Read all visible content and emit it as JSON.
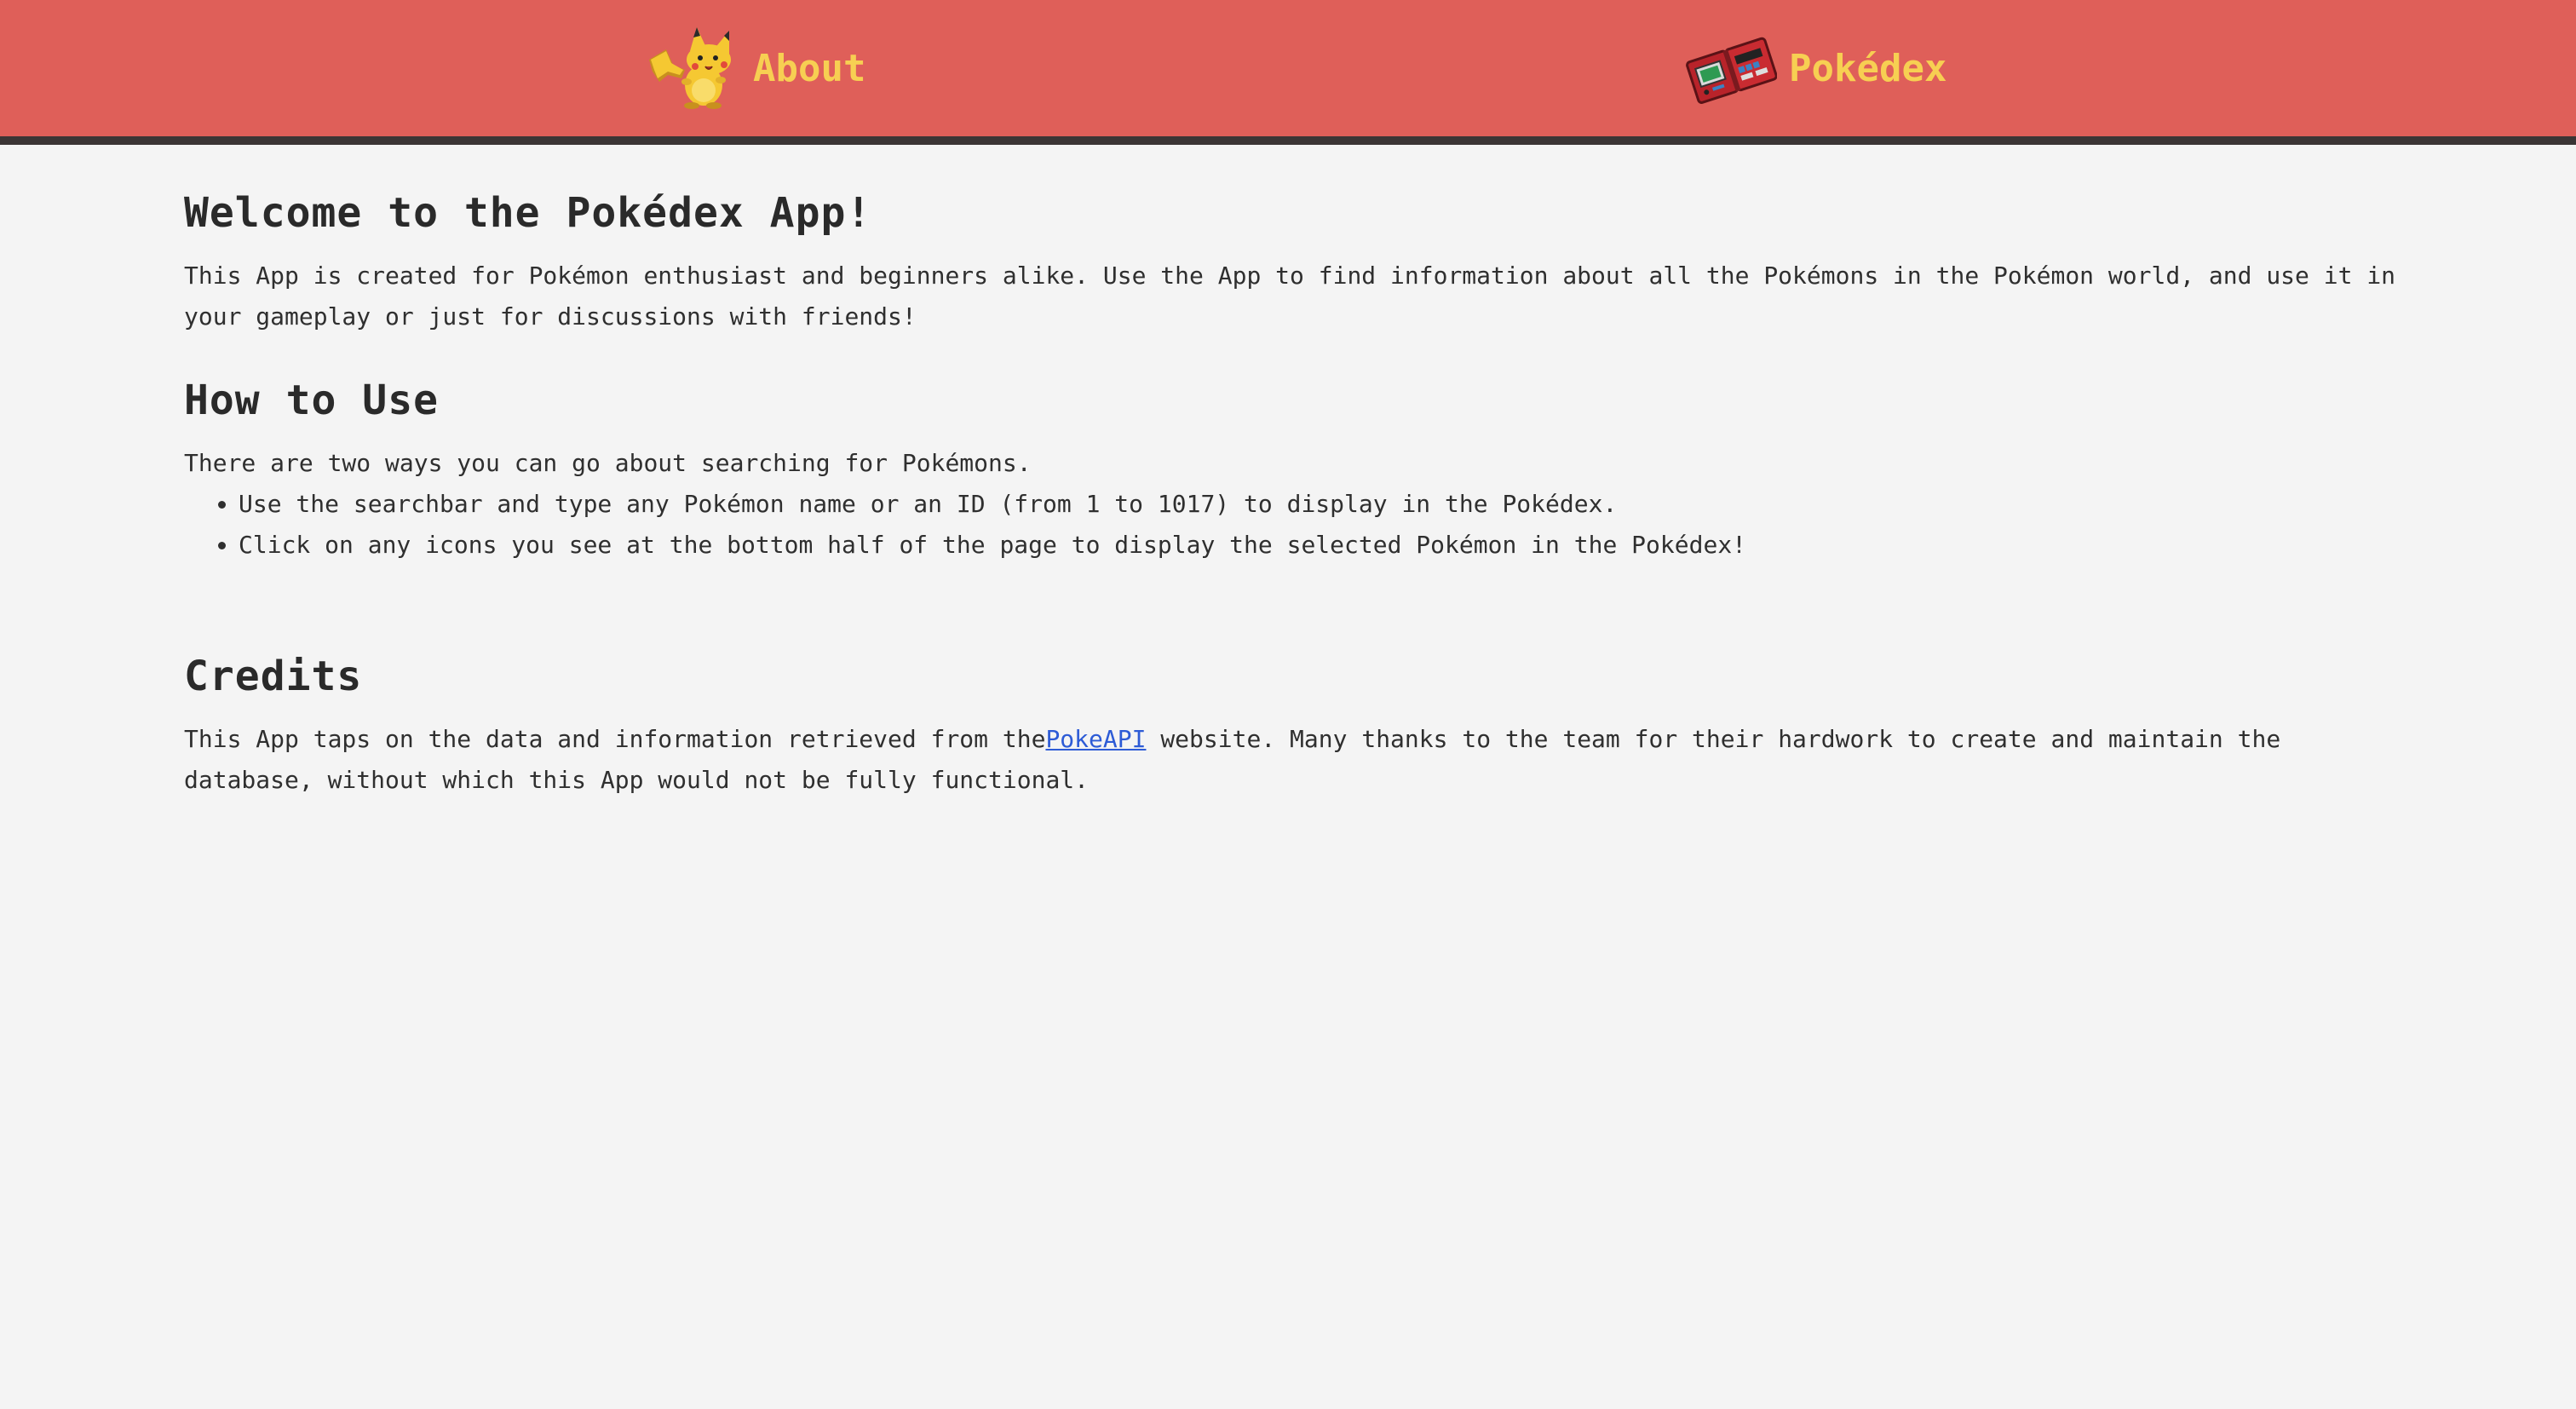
{
  "nav": {
    "about_label": "About",
    "pokedex_label": "Pokédex",
    "about_icon": "pikachu-icon",
    "pokedex_icon": "pokedex-device-icon"
  },
  "welcome": {
    "title": "Welcome to the Pokédex App!",
    "text": "This App is created for Pokémon enthusiast and beginners alike. Use the App to find information about all the Pokémons in the Pokémon world, and use it in your gameplay or just for discussions with friends!"
  },
  "howto": {
    "title": "How to Use",
    "intro": "There are two ways you can go about searching for Pokémons.",
    "items": [
      "Use the searchbar and type any Pokémon name or an ID (from 1 to 1017) to display in the Pokédex.",
      "Click on any icons you see at the bottom half of the page to display the selected Pokémon in the Pokédex!"
    ]
  },
  "credits": {
    "title": "Credits",
    "text_before": "This App taps on the data and information retrieved from the",
    "link_label": "PokeAPI",
    "text_after": " website. Many thanks to the team for their hardwork to create and maintain the database, without which this App would not be fully functional."
  },
  "colors": {
    "nav_bg": "#df5f59",
    "nav_text": "#f7cf52",
    "nav_border": "#3b3535",
    "page_bg": "#f4f4f4",
    "link": "#2d5bd6"
  }
}
